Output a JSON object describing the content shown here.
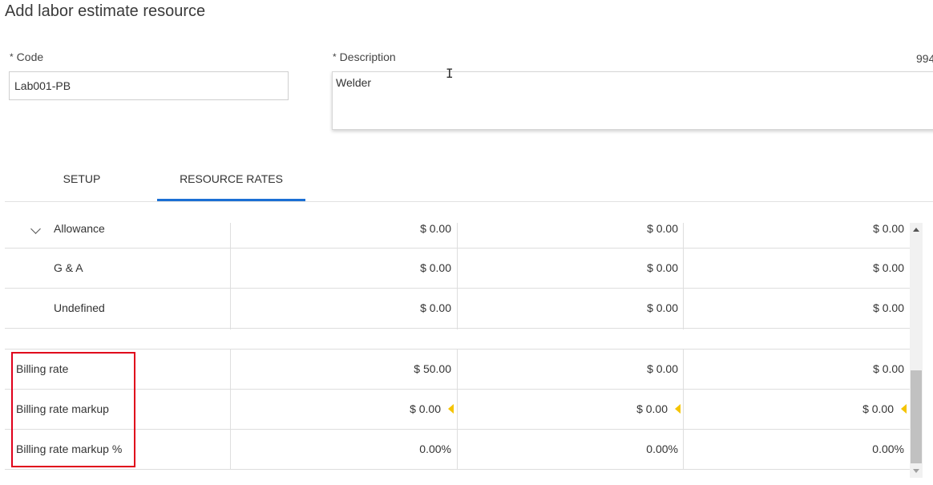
{
  "page_title": "Add labor estimate resource",
  "form": {
    "code_label": "Code",
    "code_value": "Lab001-PB",
    "description_label": "Description",
    "description_value": "Welder",
    "char_counter": "994",
    "required_marker": "*"
  },
  "tabs": [
    {
      "label": "SETUP",
      "active": false
    },
    {
      "label": "RESOURCE RATES",
      "active": true
    }
  ],
  "rows_top": [
    {
      "label": "Allowance",
      "values": [
        "$ 0.00",
        "$ 0.00",
        "$ 0.00"
      ],
      "expandable": true
    },
    {
      "label": "G & A",
      "values": [
        "$ 0.00",
        "$ 0.00",
        "$ 0.00"
      ]
    },
    {
      "label": "Undefined",
      "values": [
        "$ 0.00",
        "$ 0.00",
        "$ 0.00"
      ]
    }
  ],
  "rows_billing": [
    {
      "label": "Billing rate",
      "values": [
        "$ 50.00",
        "$ 0.00",
        "$ 0.00"
      ]
    },
    {
      "label": "Billing rate markup",
      "values": [
        "$ 0.00",
        "$ 0.00",
        "$ 0.00"
      ],
      "warning": true
    },
    {
      "label": "Billing rate markup %",
      "values": [
        "0.00%",
        "0.00%",
        "0.00%"
      ]
    }
  ],
  "colors": {
    "accent": "#1b6fd4",
    "highlight_border": "#e0001b",
    "warning_indicator": "#f5c400"
  }
}
